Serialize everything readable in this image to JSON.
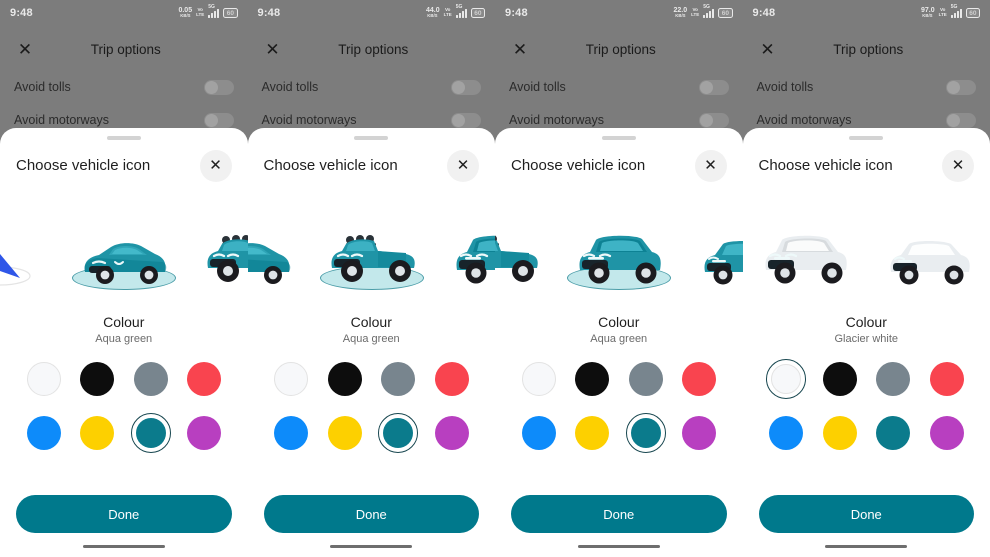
{
  "meta": {
    "screen_count": 4,
    "accent_teal": "#00798c",
    "sheet_bg": "#ffffff",
    "scrim": "#7c7c7c"
  },
  "status_bar": {
    "time": "9:48",
    "speed_unit": "KB/S",
    "volte_top": "Vo",
    "volte_bottom": "LTE",
    "network_gen": "5G",
    "battery": "60",
    "speeds": [
      "0.05",
      "44.0",
      "22.0",
      "97.0"
    ]
  },
  "app_bar": {
    "close_icon": "close-icon",
    "title": "Trip options"
  },
  "settings": [
    {
      "label": "Avoid tolls",
      "enabled": false
    },
    {
      "label": "Avoid motorways",
      "enabled": false
    }
  ],
  "sheet": {
    "title": "Choose vehicle icon",
    "close_icon": "close-icon",
    "grabber": "drag-handle"
  },
  "colour_section": {
    "heading": "Colour",
    "names": [
      "Aqua green",
      "Aqua green",
      "Aqua green",
      "Glacier white"
    ]
  },
  "swatches": [
    {
      "name": "Glacier white",
      "hex": "#f7f8fa",
      "light": true
    },
    {
      "name": "Black",
      "hex": "#0d0d0d",
      "light": false
    },
    {
      "name": "Slate grey",
      "hex": "#78858e",
      "light": false
    },
    {
      "name": "Coral red",
      "hex": "#f9444f",
      "light": false
    },
    {
      "name": "Bright blue",
      "hex": "#0d8bfa",
      "light": false
    },
    {
      "name": "Yellow",
      "hex": "#fdd000",
      "light": false
    },
    {
      "name": "Aqua green",
      "hex": "#0b7b8c",
      "light": false
    },
    {
      "name": "Magenta",
      "hex": "#b83fc0",
      "light": false
    }
  ],
  "selected_swatch_index": [
    6,
    6,
    6,
    0
  ],
  "vehicles": {
    "types": [
      "navigation-arrow",
      "sports-car",
      "pickup-truck",
      "suv",
      "hatchback"
    ],
    "selected_per_panel": [
      "sports-car",
      "pickup-truck",
      "suv",
      "sports-car"
    ],
    "body_colour_per_panel": [
      "#1f94a6",
      "#1f94a6",
      "#1f94a6",
      "#e9edf0"
    ]
  },
  "footer": {
    "done_label": "Done",
    "gesture_bar": "home-indicator"
  }
}
